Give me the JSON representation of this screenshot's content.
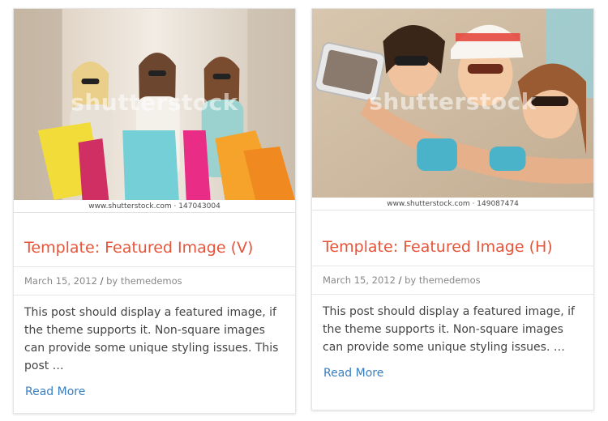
{
  "posts": [
    {
      "image_alt": "Three women with shopping bags",
      "watermark": "shutterstock",
      "credit": "www.shutterstock.com · 147043004",
      "title": "Template: Featured Image (V)",
      "date": "March 15, 2012",
      "separator": "/",
      "by": "by",
      "author": "themedemos",
      "excerpt": "This post should display a featured image, if the theme supports it. Non-square images can provide some unique styling issues. This post …",
      "read_more": "Read More"
    },
    {
      "image_alt": "Three women taking a selfie on the beach",
      "watermark": "shutterstock",
      "credit": "www.shutterstock.com · 149087474",
      "title": "Template: Featured Image (H)",
      "date": "March 15, 2012",
      "separator": "/",
      "by": "by",
      "author": "themedemos",
      "excerpt": "This post should display a featured image, if the theme supports it. Non-square images can provide some unique styling issues. …",
      "read_more": "Read More"
    }
  ],
  "colors": {
    "title": "#e6553a",
    "link": "#3a7fc1",
    "meta": "#888888",
    "text": "#444444"
  }
}
